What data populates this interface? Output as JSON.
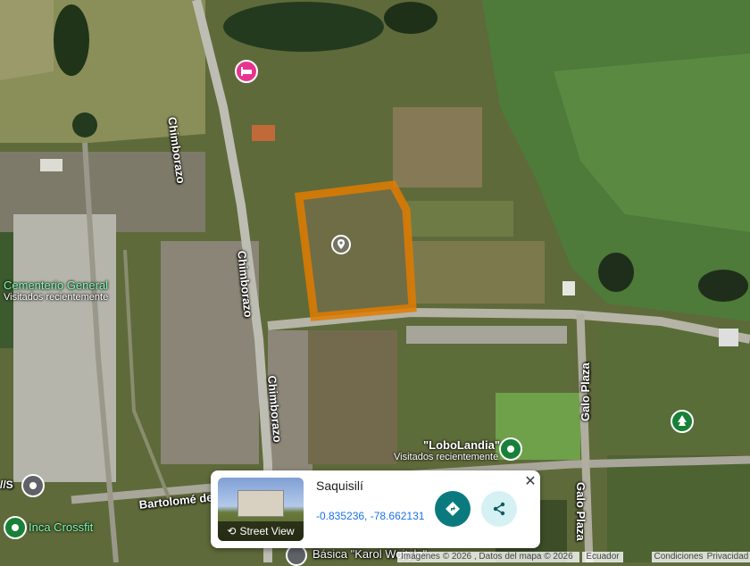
{
  "map": {
    "roads": {
      "chimborazo": "Chimborazo",
      "bartolome": "Bartolomé de",
      "galo_plaza": "Galo Plaza",
      "cut_left": "//S"
    },
    "pois": {
      "cementerio": {
        "name": "Cementerio General",
        "sub": "Visitados recientemente"
      },
      "lobolandia": {
        "name": "\"LoboLandia\"",
        "sub": "Visitados recientemente"
      },
      "inca": {
        "name": "Inca Crossfit"
      },
      "basica": {
        "name": "Básica \"Karol Wojtyla\""
      }
    },
    "colors": {
      "selection": "#e07b00",
      "poi": "#188038",
      "hotel": "#e8348f"
    }
  },
  "place_card": {
    "title": "Saquisilí",
    "coordinates": "-0.835236, -78.662131",
    "street_view_label": "Street View"
  },
  "footer": {
    "imagery": "Imágenes © 2026 , Datos del mapa © 2026",
    "country": "Ecuador",
    "terms": "Condiciones",
    "privacy": "Privacidad"
  }
}
